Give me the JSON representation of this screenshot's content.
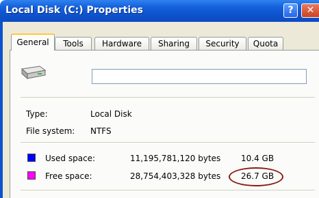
{
  "window": {
    "title": "Local Disk (C:) Properties"
  },
  "titlebar_buttons": {
    "help": "?",
    "close": "✕"
  },
  "tabs": [
    {
      "label": "General",
      "active": true
    },
    {
      "label": "Tools",
      "active": false
    },
    {
      "label": "Hardware",
      "active": false
    },
    {
      "label": "Sharing",
      "active": false
    },
    {
      "label": "Security",
      "active": false
    },
    {
      "label": "Quota",
      "active": false
    }
  ],
  "general": {
    "name_value": "",
    "type_label": "Type:",
    "type_value": "Local Disk",
    "fs_label": "File system:",
    "fs_value": "NTFS",
    "used": {
      "label": "Used space:",
      "bytes": "11,195,781,120 bytes",
      "size": "10.4 GB",
      "color": "#0000ff"
    },
    "free": {
      "label": "Free space:",
      "bytes": "28,754,403,328 bytes",
      "size": "26.7 GB",
      "color": "#ff00ff"
    }
  },
  "icons": [
    "drive-icon",
    "help-icon",
    "close-icon"
  ],
  "colors": {
    "titlebar": "#0e55d0",
    "dialog_bg": "#ece9d8",
    "annotation": "#8a1c14"
  }
}
